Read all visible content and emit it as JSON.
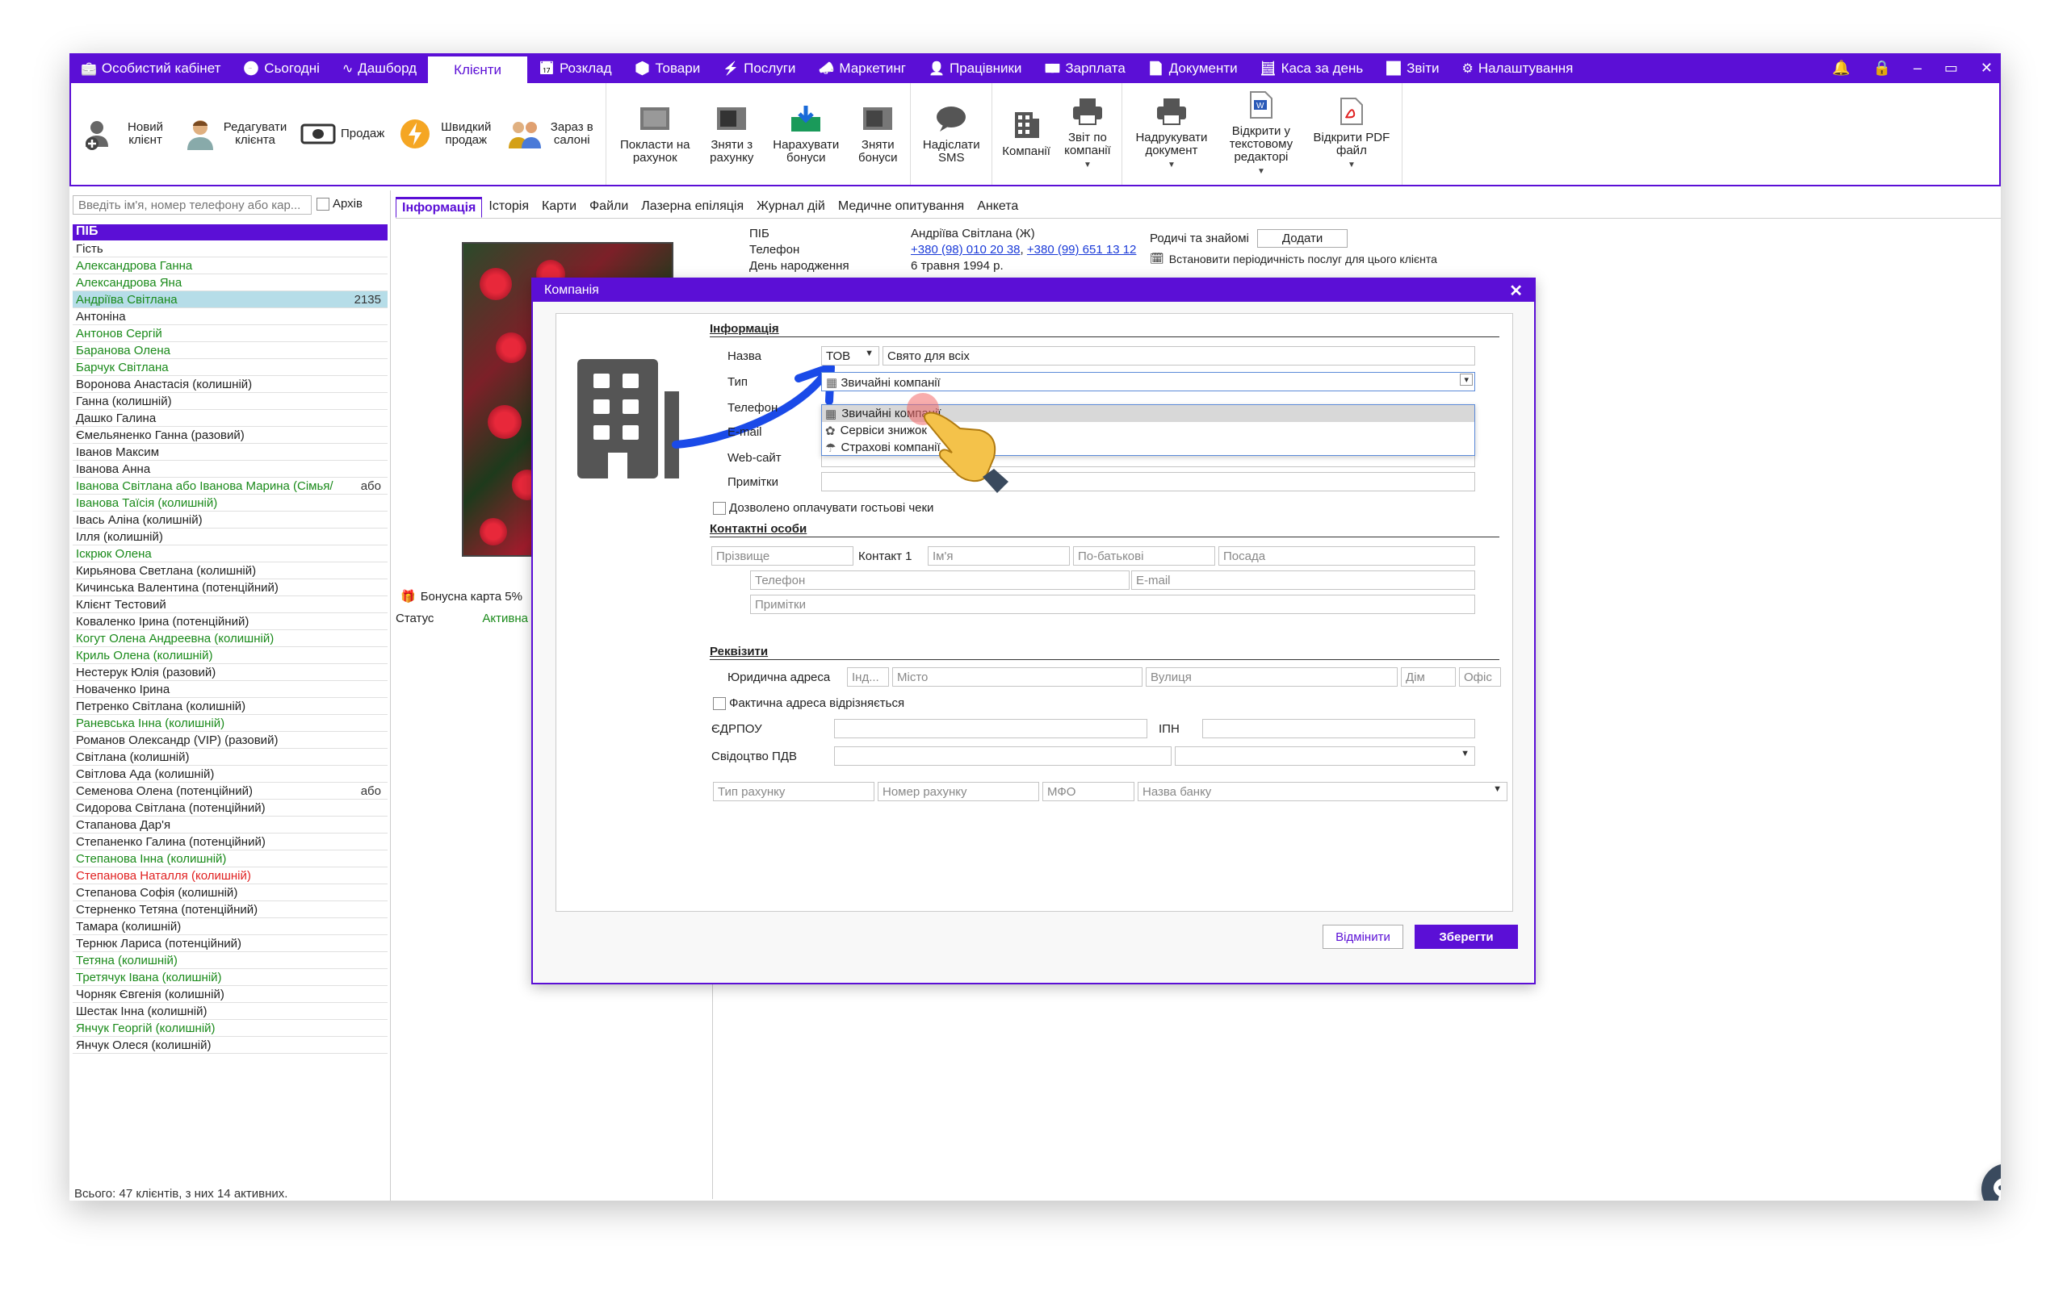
{
  "topbar": {
    "tabs": [
      {
        "label": "Особистий кабінет",
        "icon": "briefcase-icon"
      },
      {
        "label": "Сьогодні",
        "icon": "clock-icon"
      },
      {
        "label": "Дашборд",
        "icon": "pulse-icon"
      },
      {
        "label": "Клієнти",
        "icon": "",
        "active": true
      },
      {
        "label": "Розклад",
        "icon": "calendar-icon"
      },
      {
        "label": "Товари",
        "icon": "box-icon"
      },
      {
        "label": "Послуги",
        "icon": "bolt-icon"
      },
      {
        "label": "Маркетинг",
        "icon": "megaphone-icon"
      },
      {
        "label": "Працівники",
        "icon": "user-icon"
      },
      {
        "label": "Зарплата",
        "icon": "cash-icon"
      },
      {
        "label": "Документи",
        "icon": "document-icon"
      },
      {
        "label": "Каса за день",
        "icon": "calculator-icon"
      },
      {
        "label": "Звіти",
        "icon": "bar-chart-icon"
      },
      {
        "label": "Налаштування",
        "icon": "gear-icon"
      }
    ]
  },
  "ribbon": {
    "new_client": "Новий клієнт",
    "edit_client": "Редагувати клієнта",
    "sale": "Продаж",
    "quick_sale": "Швидкий продаж",
    "now_in_salon": "Зараз в салоні",
    "put_on_account": "Покласти на рахунок",
    "withdraw_account": "Зняти з рахунку",
    "accrue_bonus": "Нарахувати бонуси",
    "withdraw_bonus": "Зняти бонуси",
    "send_sms": "Надіслати SMS",
    "companies": "Компанії",
    "company_report": "Звіт по компанії",
    "print_document": "Надрукувати документ",
    "open_text_editor": "Відкрити у текстовому редакторі",
    "open_pdf": "Відкрити PDF файл"
  },
  "clients": {
    "search_placeholder": "Введіть ім'я, номер телефону або кар...",
    "archive_label": "Архів",
    "header": "ПІБ",
    "rows": [
      {
        "name": "Гість",
        "color": "black"
      },
      {
        "name": "Александрова Ганна",
        "color": "green"
      },
      {
        "name": "Александрова Яна",
        "color": "green"
      },
      {
        "name": "Андріїва Світлана",
        "color": "green",
        "extra": "2135",
        "selected": true
      },
      {
        "name": "Антоніна",
        "color": "black"
      },
      {
        "name": "Антонов Сергій",
        "color": "green"
      },
      {
        "name": "Баранова Олена",
        "color": "green"
      },
      {
        "name": "Барчук Світлана",
        "color": "green"
      },
      {
        "name": "Воронова Анастасія (колишній)",
        "color": "black"
      },
      {
        "name": "Ганна (колишній)",
        "color": "black"
      },
      {
        "name": "Дашко Галина",
        "color": "black"
      },
      {
        "name": "Ємельяненко Ганна (разовий)",
        "color": "black"
      },
      {
        "name": "Іванов Максим",
        "color": "black"
      },
      {
        "name": "Іванова Анна",
        "color": "black"
      },
      {
        "name": "Іванова Світлана  або Іванова  Марина (Сімья/",
        "color": "green",
        "extra": "або"
      },
      {
        "name": "Іванова Таїсія (колишній)",
        "color": "green"
      },
      {
        "name": "Івась Аліна (колишній)",
        "color": "black"
      },
      {
        "name": "Ілля (колишній)",
        "color": "black"
      },
      {
        "name": "Іскрюк Олена",
        "color": "green"
      },
      {
        "name": "Кирьянова Светлана (колишній)",
        "color": "black"
      },
      {
        "name": "Кичинська Валентина (потенційний)",
        "color": "black"
      },
      {
        "name": "Клієнт Тестовий",
        "color": "black"
      },
      {
        "name": "Коваленко Ірина (потенційний)",
        "color": "black"
      },
      {
        "name": "Когут Олена Андреевна (колишній)",
        "color": "green"
      },
      {
        "name": "Криль Олена (колишній)",
        "color": "green"
      },
      {
        "name": "Нестерук Юлія (разовий)",
        "color": "black"
      },
      {
        "name": "Новаченко Ірина",
        "color": "black"
      },
      {
        "name": "Петренко Світлана (колишній)",
        "color": "black"
      },
      {
        "name": "Раневська Інна (колишній)",
        "color": "green"
      },
      {
        "name": "Романов Олександр (VIP) (разовий)",
        "color": "black"
      },
      {
        "name": "Світлана (колишній)",
        "color": "black"
      },
      {
        "name": "Світлова Ада (колишній)",
        "color": "black"
      },
      {
        "name": "Семенова Олена (потенційний)",
        "color": "black",
        "extra": "або"
      },
      {
        "name": "Сидорова Світлана (потенційний)",
        "color": "black"
      },
      {
        "name": "Стапанова Дар'я",
        "color": "black"
      },
      {
        "name": "Степаненко Галина (потенційний)",
        "color": "black"
      },
      {
        "name": "Степанова Інна (колишній)",
        "color": "green"
      },
      {
        "name": "Степанова Наталля (колишній)",
        "color": "red"
      },
      {
        "name": "Степанова Софія (колишній)",
        "color": "black"
      },
      {
        "name": "Стерненко Тетяна (потенційний)",
        "color": "black"
      },
      {
        "name": "Тамара (колишній)",
        "color": "black"
      },
      {
        "name": "Тернюк Лариса (потенційний)",
        "color": "black"
      },
      {
        "name": "Тетяна (колишній)",
        "color": "green"
      },
      {
        "name": "Третячук Івана (колишній)",
        "color": "green"
      },
      {
        "name": "Чорняк Євгенія (колишній)",
        "color": "black"
      },
      {
        "name": "Шестак Інна (колишній)",
        "color": "black"
      },
      {
        "name": "Янчук Георгій (колишній)",
        "color": "green"
      },
      {
        "name": "Янчук Олеся (колишній)",
        "color": "black"
      }
    ],
    "total": "Всього: 47 клієнтів, з них 14 активних."
  },
  "details": {
    "tabs": [
      "Інформація",
      "Історія",
      "Карти",
      "Файли",
      "Лазерна епіляція",
      "Журнал дій",
      "Медичне опитування",
      "Анкета"
    ],
    "labels": {
      "pib": "ПІБ",
      "phone": "Телефон",
      "birthday": "День народження"
    },
    "name": "Андріїва Світлана (Ж)",
    "phone1": "+380 (98) 010 20 38",
    "phone2": "+380 (99) 651 13 12",
    "birthday": "6 травня 1994 р.",
    "relatives_label": "Родичі та знайомі",
    "add_button": "Додати",
    "periodic_link": "Встановити періодичність послуг для цього клієнта",
    "bonus_card": "Бонусна карта 5%",
    "status_label": "Статус",
    "status_value": "Активна"
  },
  "dialog": {
    "title": "Компанія",
    "section_info": "Інформація",
    "name_label": "Назва",
    "org_form": "ТОВ",
    "name_value": "Свято для всіх",
    "type_label": "Тип",
    "type_value": "Звичайні компанії",
    "type_options": [
      "Звичайні компанії",
      "Сервіси знижок",
      "Страхові компанії"
    ],
    "phone_label": "Телефон",
    "email_label": "E-mail",
    "website_label": "Web-сайт",
    "notes_label": "Примітки",
    "guest_checks": "Дозволено оплачувати гостьові чеки",
    "section_contacts": "Контактні особи",
    "contact": {
      "surname": "Прізвище",
      "contact1": "Контакт 1",
      "name": "Ім'я",
      "patronymic": "По-батькові",
      "position": "Посада",
      "phone": "Телефон",
      "email": "E-mail",
      "notes": "Примітки"
    },
    "section_requisites": "Реквізити",
    "legal_address": "Юридична адреса",
    "index_ph": "Інд...",
    "city_ph": "Місто",
    "street_ph": "Вулиця",
    "house_ph": "Дім",
    "office_ph": "Офіс",
    "actual_address": "Фактична адреса відрізняється",
    "edrpou": "ЄДРПОУ",
    "ipn": "ІПН",
    "vat_cert": "Свідоцтво ПДВ",
    "account_type": "Тип рахунку",
    "account_number": "Номер рахунку",
    "mfo": "МФО",
    "bank_name": "Назва банку",
    "cancel": "Відмінити",
    "save": "Зберегти"
  },
  "colors": {
    "accent": "#5b0fd6",
    "green": "#1a8a1a",
    "red": "#e02020",
    "selected": "#b6dde8"
  }
}
